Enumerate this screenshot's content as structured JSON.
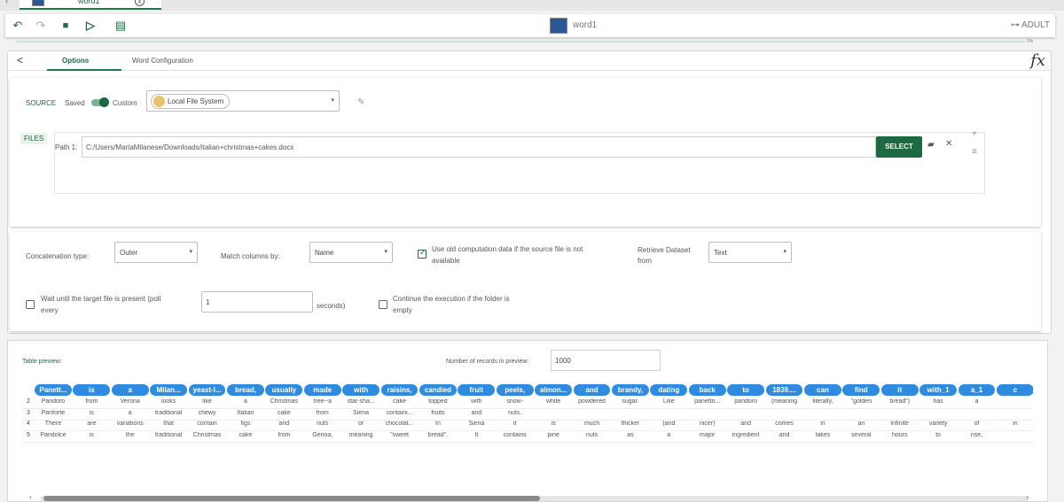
{
  "window_tab": {
    "label": "word1",
    "close": "x"
  },
  "toolbar": {
    "title": "word1",
    "user": "ADULT",
    "undo": "↶",
    "redo": "↷",
    "save": "■",
    "run": "▷",
    "doc": "▤"
  },
  "progress": {
    "label": "0%",
    "value": 0
  },
  "tabs": {
    "back": "<",
    "options": "Options",
    "config": "Word Configuration",
    "fx": "fx"
  },
  "source": {
    "label": "SOURCE",
    "saved": "Saved",
    "custom": "Custom",
    "filesystem": "Local File System",
    "files_tag": "FILES",
    "path_label": "Path 1:",
    "path_value": "C:/Users/MartaMilanese/Downloads/italian+christmas+cakes.docx",
    "select_button": "SELECT"
  },
  "options": {
    "concat_label": "Concatenation type:",
    "concat_value": "Outer",
    "match_label": "Match columns by:",
    "match_value": "Name",
    "use_old_label_1": "Use old computation data if the source file is not",
    "use_old_label_2": "available",
    "retrieve_label_1": "Retrieve Dataset",
    "retrieve_label_2": "from",
    "retrieve_value": "Text",
    "wait_label_1": "Wait until the target file is present (poll",
    "wait_label_2": "every",
    "wait_value": "1",
    "seconds_label": "seconds)",
    "continue_label_1": "Continue the execution if the folder is",
    "continue_label_2": "empty"
  },
  "preview": {
    "label": "Table preview:",
    "records_label": "Number of records in preview:",
    "records_value": "1000",
    "headers": [
      "Panett...",
      "is",
      "a",
      "Milan...",
      "yeast-l...",
      "bread,",
      "usually",
      "made",
      "with",
      "raisins,",
      "candied",
      "fruit",
      "peels,",
      "almon...",
      "and",
      "brandy,",
      "dating",
      "back",
      "to",
      "1839....",
      "can",
      "find",
      "it",
      "with_1",
      "a_1",
      "c"
    ],
    "row_numbers": [
      "2",
      "3",
      "4",
      "5"
    ],
    "rows": [
      [
        "Pandoro",
        "from",
        "Verona",
        "looks",
        "like",
        "a",
        "Christmas",
        "tree--a",
        "star-sha...",
        "cake",
        "topped",
        "with",
        "snow-",
        "white",
        "powdered",
        "sugar.",
        "Like",
        "panetto...",
        "pandoro",
        "(meaning",
        "literally,",
        "\"golden",
        "bread\")",
        "has",
        "a",
        ""
      ],
      [
        "Panforte",
        "is",
        "a",
        "traditional",
        "chewy",
        "Italian",
        "cake",
        "from",
        "Siena",
        "containi...",
        "fruits",
        "and",
        "nuts.",
        "",
        "",
        "",
        "",
        "",
        "",
        "",
        "",
        "",
        "",
        "",
        "",
        ""
      ],
      [
        "There",
        "are",
        "variations",
        "that",
        "contain",
        "figs",
        "and",
        "nuts",
        "or",
        "chocolat...",
        "In",
        "Siena",
        "it",
        "is",
        "much",
        "thicker",
        "(and",
        "nicer)",
        "and",
        "comes",
        "in",
        "an",
        "infinite",
        "variety",
        "of",
        "in"
      ],
      [
        "Pandolce",
        "is",
        "the",
        "traditional",
        "Christmas",
        "cake",
        "from",
        "Genoa,",
        "meaning",
        "\"sweet",
        "bread\".",
        "It",
        "contains",
        "pine",
        "nuts",
        "as",
        "a",
        "major",
        "ingredient",
        "and",
        "takes",
        "several",
        "hours",
        "to",
        "rise,",
        ""
      ]
    ]
  }
}
